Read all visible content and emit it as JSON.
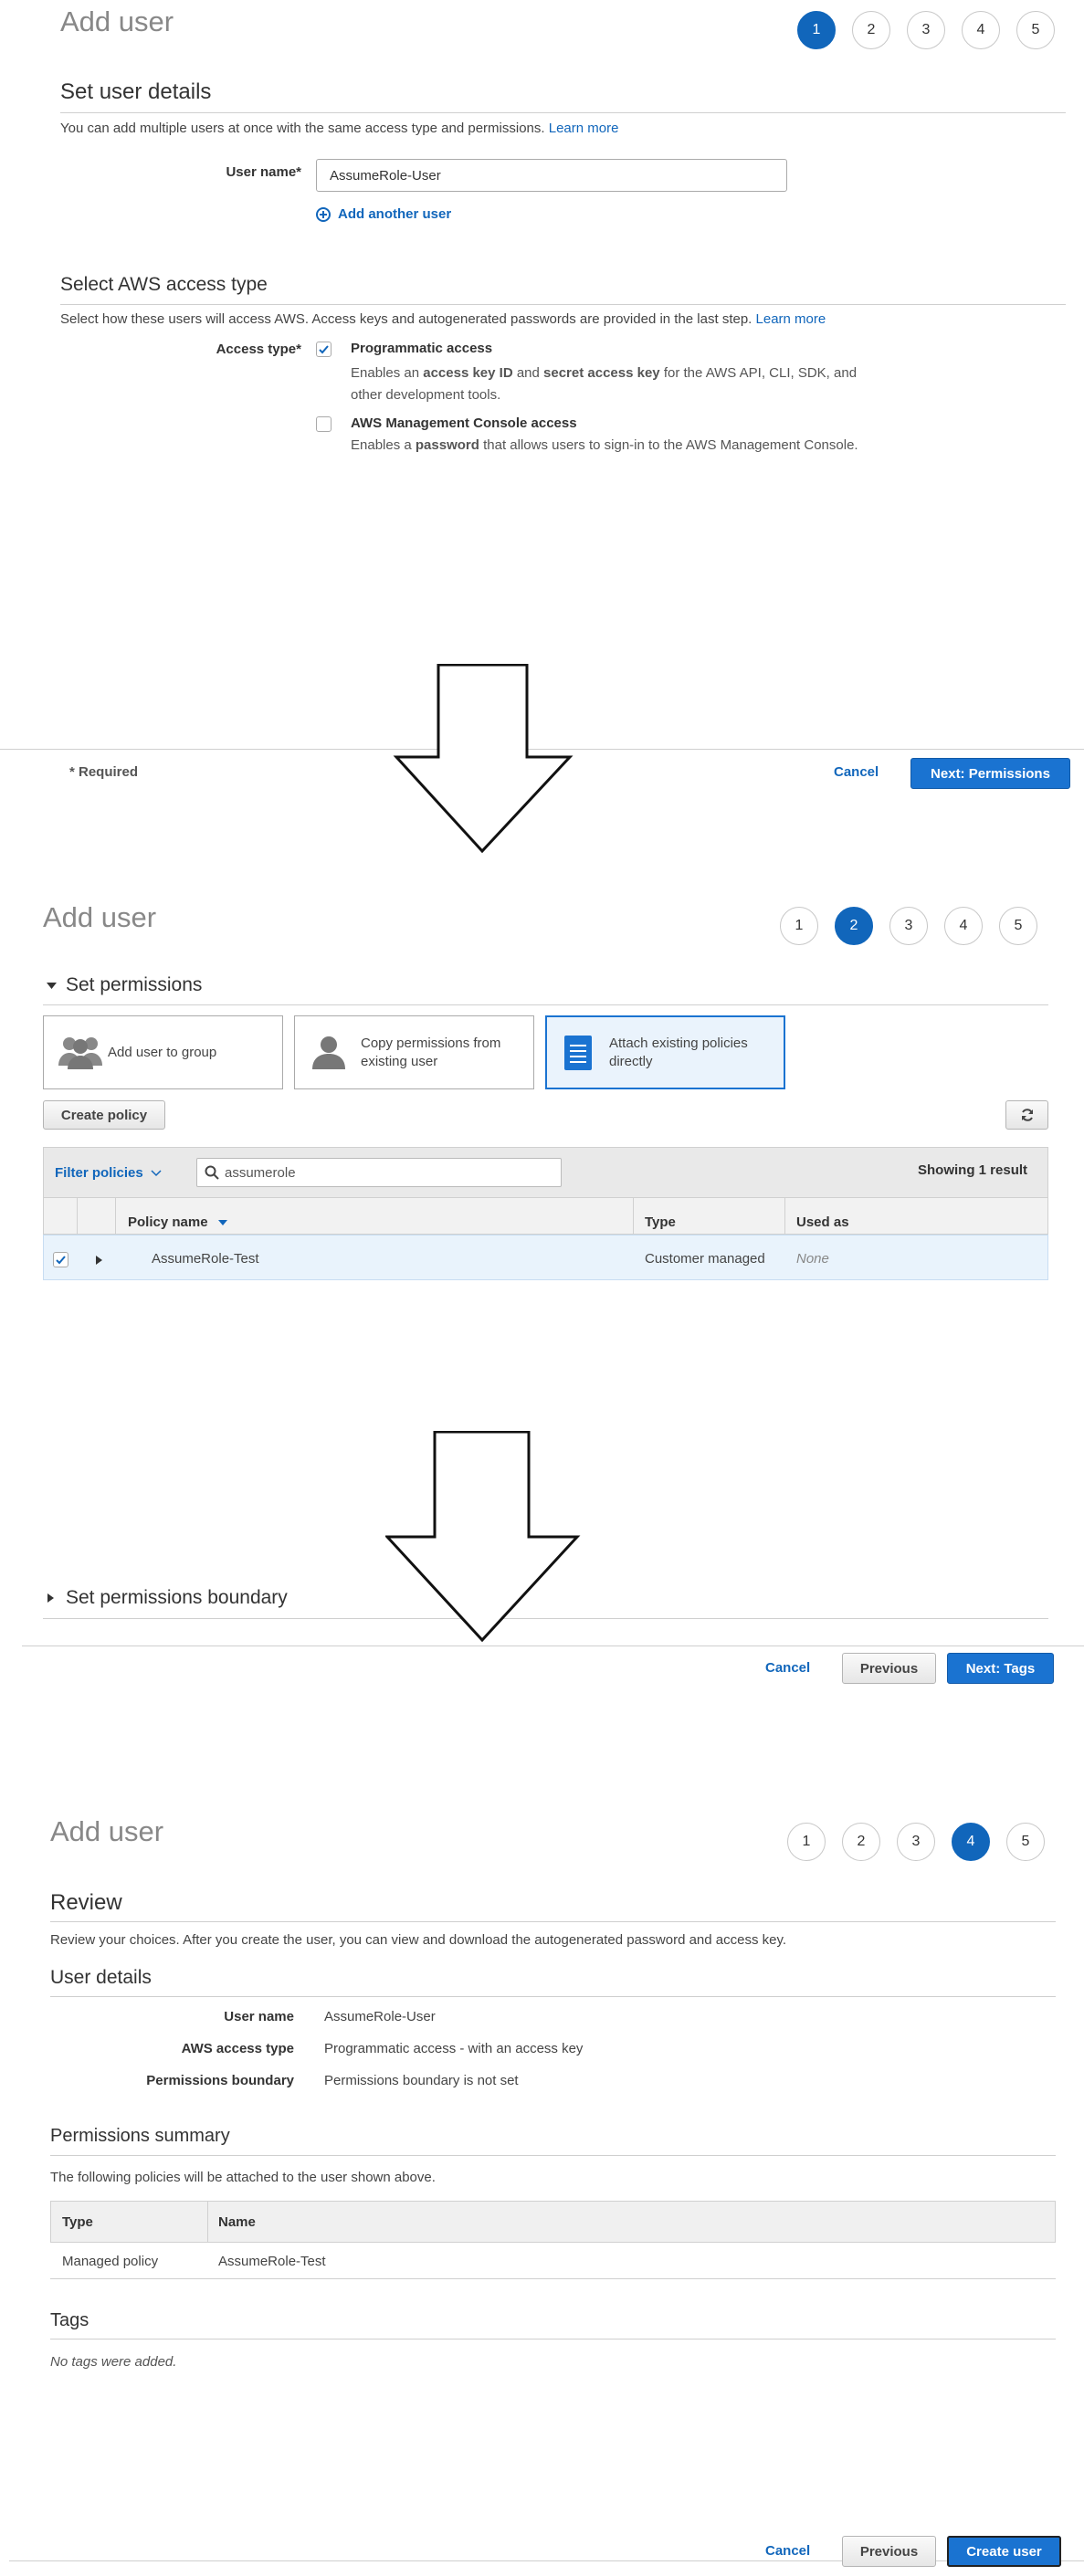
{
  "panel1": {
    "title": "Add user",
    "steps": [
      "1",
      "2",
      "3",
      "4",
      "5"
    ],
    "active_step": 1,
    "section_title": "Set user details",
    "intro": "You can add multiple users at once with the same access type and permissions.",
    "intro_link": "Learn more",
    "username_label": "User name*",
    "username_value": "AssumeRole-User",
    "add_another": "Add another user",
    "access_section": "Select AWS access type",
    "access_intro": "Select how these users will access AWS. Access keys and autogenerated passwords are provided in the last step.",
    "access_link": "Learn more",
    "access_type_label": "Access type*",
    "opt1_title": "Programmatic access",
    "opt1_desc_a": "Enables an ",
    "opt1_desc_b": "access key ID",
    "opt1_desc_c": " and ",
    "opt1_desc_d": "secret access key",
    "opt1_desc_e": " for the AWS API, CLI, SDK, and",
    "opt1_desc_line2": "other development tools.",
    "opt1_checked": true,
    "opt2_title": "AWS Management Console access",
    "opt2_desc_a": "Enables a ",
    "opt2_desc_b": "password",
    "opt2_desc_c": " that allows users to sign-in to the AWS Management Console.",
    "opt2_checked": false,
    "required_note": "* Required",
    "cancel": "Cancel",
    "next": "Next: Permissions"
  },
  "panel2": {
    "title": "Add user",
    "steps": [
      "1",
      "2",
      "3",
      "4",
      "5"
    ],
    "active_step": 2,
    "section_title": "Set permissions",
    "options": [
      {
        "label_1": "Add user to group",
        "label_2": ""
      },
      {
        "label_1": "Copy permissions from",
        "label_2": "existing user"
      },
      {
        "label_1": "Attach existing policies",
        "label_2": "directly"
      }
    ],
    "create_policy": "Create policy",
    "filter": "Filter policies",
    "search_value": "assumerole",
    "result_count": "Showing 1 result",
    "columns": [
      "Policy name",
      "Type",
      "Used as"
    ],
    "rows": [
      {
        "name": "AssumeRole-Test",
        "type": "Customer managed",
        "used_as": "None",
        "checked": true
      }
    ],
    "boundary": "Set permissions boundary",
    "cancel": "Cancel",
    "previous": "Previous",
    "next": "Next: Tags"
  },
  "panel3": {
    "title": "Add user",
    "steps": [
      "1",
      "2",
      "3",
      "4",
      "5"
    ],
    "active_step": 4,
    "section_title": "Review",
    "intro": "Review your choices. After you create the user, you can view and download the autogenerated password and access key.",
    "user_details": "User details",
    "details": [
      {
        "label": "User name",
        "value": "AssumeRole-User"
      },
      {
        "label": "AWS access type",
        "value": "Programmatic access - with an access key"
      },
      {
        "label": "Permissions boundary",
        "value": "Permissions boundary is not set"
      }
    ],
    "perm_summary": "Permissions summary",
    "perm_intro": "The following policies will be attached to the user shown above.",
    "columns": [
      "Type",
      "Name"
    ],
    "rows": [
      {
        "type": "Managed policy",
        "name": "AssumeRole-Test"
      }
    ],
    "tags": "Tags",
    "no_tags": "No tags were added.",
    "cancel": "Cancel",
    "previous": "Previous",
    "create": "Create user"
  },
  "colors": {
    "accent": "#1166bb",
    "primary_button": "#1a73d1",
    "row_highlight": "#e9f3fc"
  },
  "icons": [
    "plus-circle-icon",
    "checkbox-check-icon",
    "group-icon",
    "user-icon",
    "document-icon",
    "refresh-icon",
    "search-icon",
    "chevron-down-icon",
    "caret-right-icon",
    "sort-down-icon",
    "down-arrow-icon"
  ]
}
